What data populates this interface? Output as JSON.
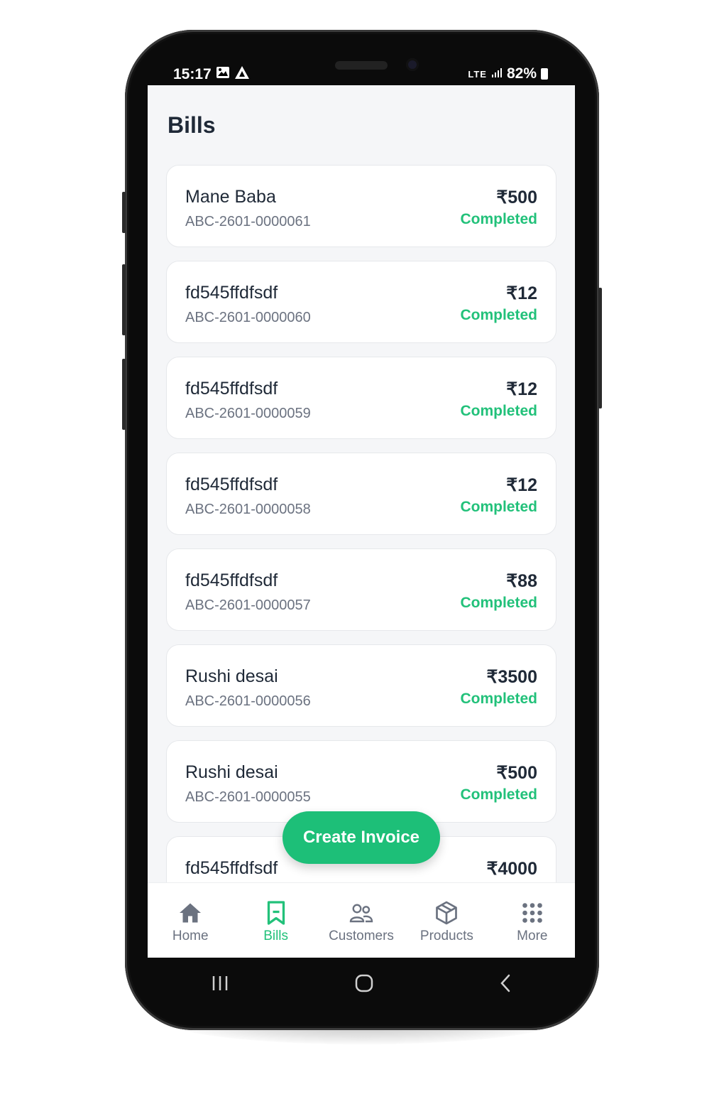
{
  "status_bar": {
    "time": "15:17",
    "signal": "LTE",
    "battery": "82%"
  },
  "header": {
    "title": "Bills"
  },
  "bills": [
    {
      "name": "Mane Baba",
      "code": "ABC-2601-0000061",
      "amount": "₹500",
      "status": "Completed"
    },
    {
      "name": "fd545ffdfsdf",
      "code": "ABC-2601-0000060",
      "amount": "₹12",
      "status": "Completed"
    },
    {
      "name": "fd545ffdfsdf",
      "code": "ABC-2601-0000059",
      "amount": "₹12",
      "status": "Completed"
    },
    {
      "name": "fd545ffdfsdf",
      "code": "ABC-2601-0000058",
      "amount": "₹12",
      "status": "Completed"
    },
    {
      "name": "fd545ffdfsdf",
      "code": "ABC-2601-0000057",
      "amount": "₹88",
      "status": "Completed"
    },
    {
      "name": "Rushi desai",
      "code": "ABC-2601-0000056",
      "amount": "₹3500",
      "status": "Completed"
    },
    {
      "name": "Rushi desai",
      "code": "ABC-2601-0000055",
      "amount": "₹500",
      "status": "Completed"
    },
    {
      "name": "fd545ffdfsdf",
      "code": "",
      "amount": "₹4000",
      "status": ""
    }
  ],
  "fab": {
    "label": "Create Invoice"
  },
  "nav": [
    {
      "label": "Home",
      "icon": "home-icon"
    },
    {
      "label": "Bills",
      "icon": "bookmark-icon",
      "active": true
    },
    {
      "label": "Customers",
      "icon": "users-icon"
    },
    {
      "label": "Products",
      "icon": "box-icon"
    },
    {
      "label": "More",
      "icon": "grid-icon"
    }
  ],
  "colors": {
    "accent": "#1dbf78",
    "status_completed": "#22c17a",
    "text_primary": "#1f2937",
    "text_secondary": "#6b7280"
  }
}
